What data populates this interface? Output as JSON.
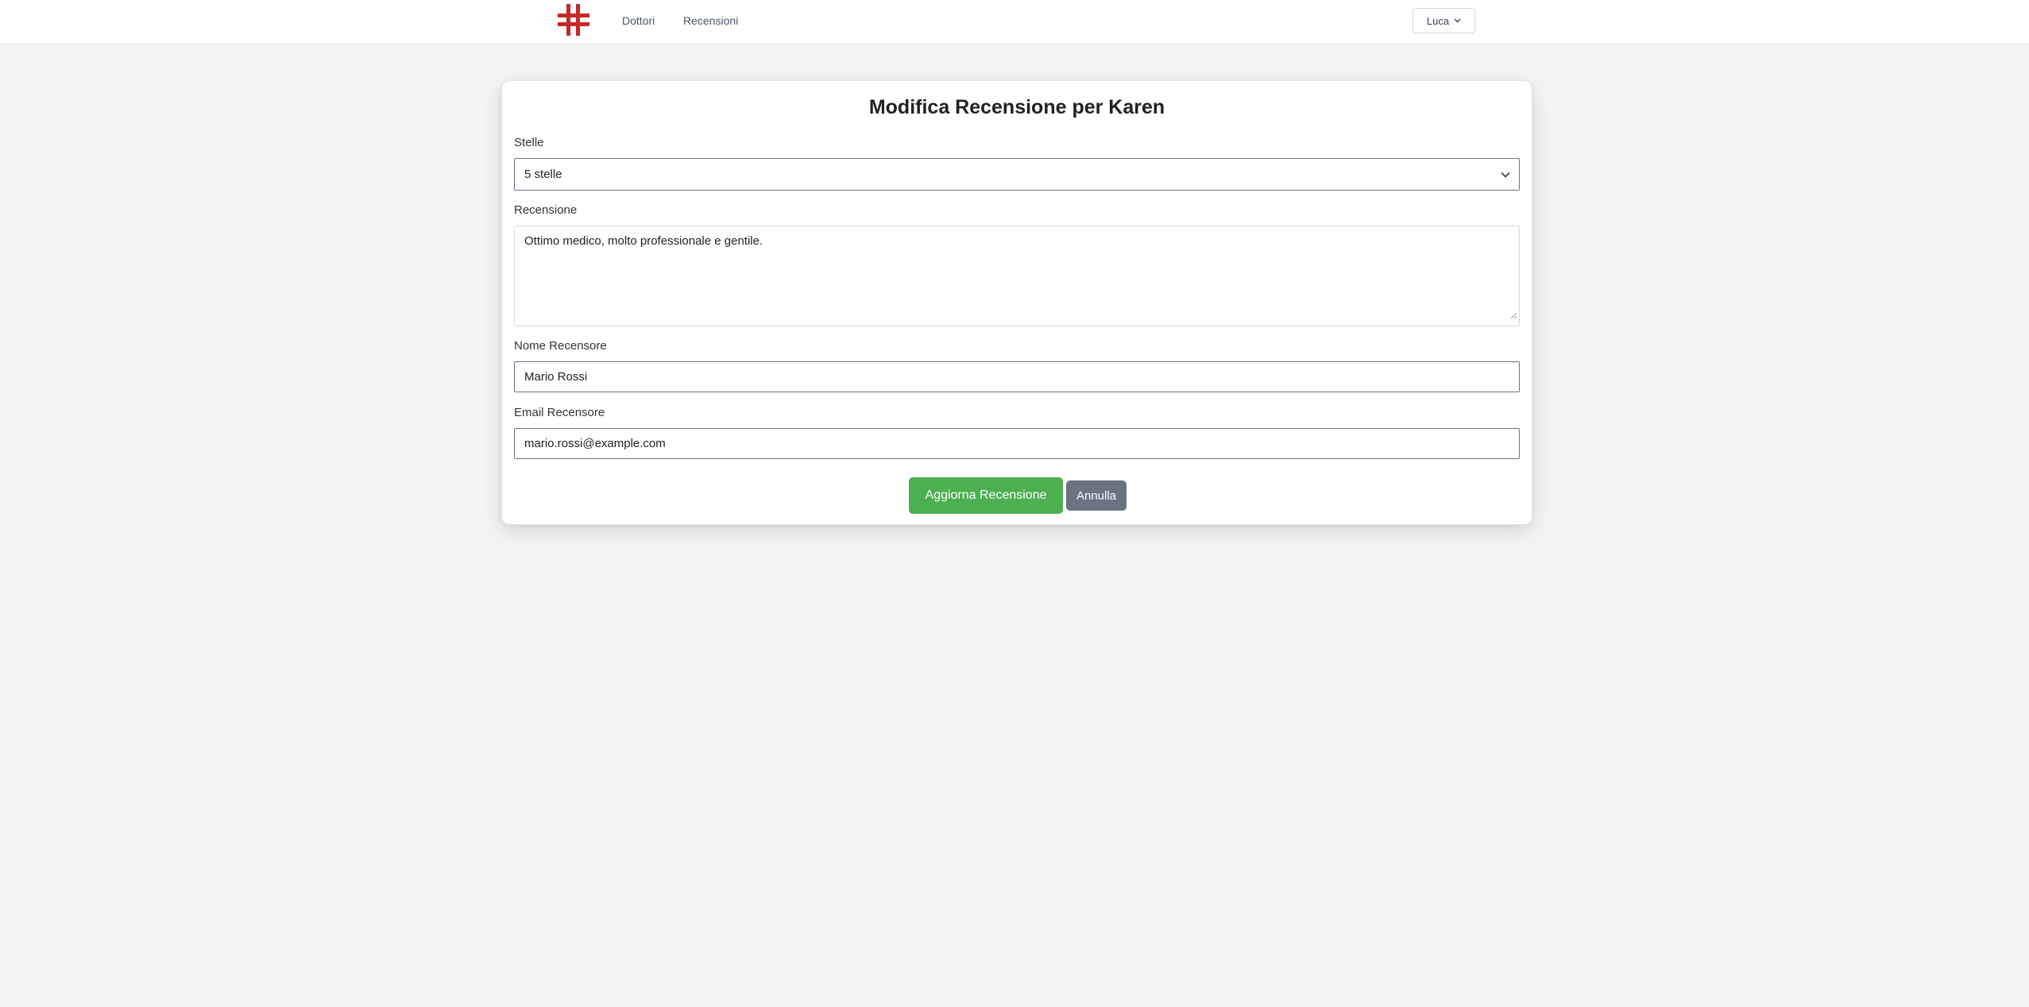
{
  "nav": {
    "logo_icon": "red-cross-logo-icon",
    "links": [
      {
        "label": "Dottori"
      },
      {
        "label": "Recensioni"
      }
    ],
    "user": {
      "name": "Luca",
      "icon": "chevron-down-icon"
    }
  },
  "form": {
    "title": "Modifica Recensione per Karen",
    "stelle": {
      "label": "Stelle",
      "selected": "5 stelle"
    },
    "recensione": {
      "label": "Recensione",
      "value": "Ottimo medico, molto professionale e gentile."
    },
    "nome": {
      "label": "Nome Recensore",
      "value": "Mario Rossi"
    },
    "email": {
      "label": "Email Recensore",
      "value": "mario.rossi@example.com"
    },
    "buttons": {
      "submit_label": "Aggiorna Recensione",
      "cancel_label": "Annulla"
    }
  },
  "colors": {
    "logo_red": "#c62828",
    "primary_button": "#4caf50",
    "secondary_button": "#6b7280",
    "page_background": "#f3f4f6"
  }
}
